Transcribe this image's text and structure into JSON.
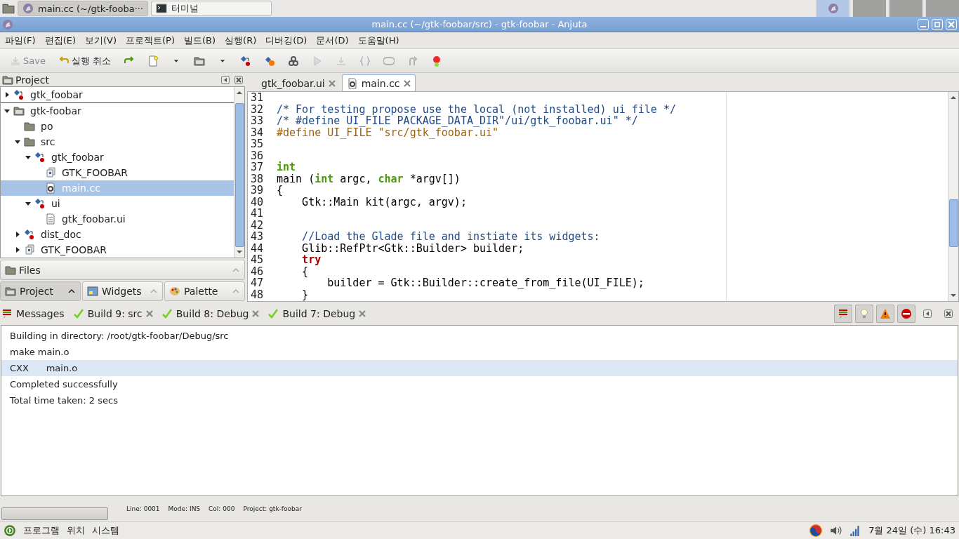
{
  "taskbar": {
    "tasks": [
      {
        "label": "main.cc (~/gtk-fooba···",
        "kind": "app",
        "selected": true
      },
      {
        "label": "터미널",
        "kind": "terminal",
        "selected": false
      }
    ],
    "workspaces": [
      {
        "selected": true
      },
      {
        "selected": false
      },
      {
        "selected": false
      },
      {
        "selected": false
      }
    ]
  },
  "window": {
    "title": "main.cc (~/gtk-foobar/src) - gtk-foobar - Anjuta"
  },
  "menu": [
    "파일(F)",
    "편집(E)",
    "보기(V)",
    "프로젝트(P)",
    "빌드(B)",
    "실행(R)",
    "디버깅(D)",
    "문서(D)",
    "도움말(H)"
  ],
  "toolbar": [
    {
      "kind": "save",
      "label": "Save",
      "disabled": true
    },
    {
      "kind": "undo",
      "label": "실행 취소",
      "disabled": false
    },
    {
      "kind": "redo",
      "disabled": false
    },
    {
      "kind": "new",
      "disabled": false
    },
    {
      "kind": "caret",
      "disabled": false
    },
    {
      "kind": "open",
      "disabled": false
    },
    {
      "kind": "caret",
      "disabled": false
    },
    {
      "kind": "target",
      "disabled": false
    },
    {
      "kind": "build",
      "disabled": false
    },
    {
      "kind": "gears",
      "disabled": false
    },
    {
      "kind": "play",
      "disabled": true
    },
    {
      "kind": "download",
      "disabled": true
    },
    {
      "kind": "braces",
      "disabled": true
    },
    {
      "kind": "loop",
      "disabled": true
    },
    {
      "kind": "loopup",
      "disabled": true
    },
    {
      "kind": "breakpoint",
      "disabled": false
    }
  ],
  "project_panel": {
    "title": "Project",
    "pinned": {
      "label": "gtk_foobar",
      "kind": "target",
      "expanded": false
    },
    "tree": [
      {
        "label": "gtk-foobar",
        "kind": "project",
        "expanded": true,
        "selected": false,
        "children": [
          {
            "label": "po",
            "kind": "folder",
            "selected": false
          },
          {
            "label": "src",
            "kind": "folder",
            "expanded": true,
            "selected": false,
            "children": [
              {
                "label": "gtk_foobar",
                "kind": "target",
                "expanded": true,
                "selected": false,
                "children": [
                  {
                    "label": "GTK_FOOBAR",
                    "kind": "lib",
                    "selected": false
                  },
                  {
                    "label": "main.cc",
                    "kind": "source",
                    "selected": true
                  }
                ]
              },
              {
                "label": "ui",
                "kind": "target",
                "expanded": true,
                "selected": false,
                "children": [
                  {
                    "label": "gtk_foobar.ui",
                    "kind": "file",
                    "selected": false
                  }
                ]
              }
            ]
          },
          {
            "label": "dist_doc",
            "kind": "target",
            "expanded": false,
            "selected": false
          },
          {
            "label": "GTK_FOOBAR",
            "kind": "lib",
            "expanded": false,
            "selected": false
          }
        ]
      }
    ],
    "files_label": "Files",
    "tabs": [
      {
        "label": "Project",
        "kind": "project",
        "selected": true
      },
      {
        "label": "Widgets",
        "kind": "widgets",
        "selected": false
      },
      {
        "label": "Palette",
        "kind": "palette",
        "selected": false
      }
    ]
  },
  "editor": {
    "tabs": [
      {
        "label": "gtk_foobar.ui",
        "kind": "plain",
        "selected": false
      },
      {
        "label": "main.cc",
        "kind": "source",
        "selected": true
      }
    ],
    "lines": [
      {
        "number": "31"
      },
      {
        "number": "32",
        "segments": [
          {
            "text": "/* For testing propose use the local (not installed) ui file */",
            "kind": "comment"
          }
        ]
      },
      {
        "number": "33",
        "segments": [
          {
            "text": "/* #define UI_FILE PACKAGE_DATA_DIR\"/ui/gtk_foobar.ui\" */",
            "kind": "comment"
          }
        ]
      },
      {
        "number": "34",
        "segments": [
          {
            "text": "#define UI_FILE \"src/gtk_foobar.ui\"",
            "kind": "preproc"
          }
        ]
      },
      {
        "number": "35"
      },
      {
        "number": "36"
      },
      {
        "number": "37",
        "segments": [
          {
            "text": "int",
            "kind": "type"
          }
        ]
      },
      {
        "number": "38",
        "segments": [
          {
            "text": "main (",
            "kind": "plain"
          },
          {
            "text": "int",
            "kind": "type"
          },
          {
            "text": " argc, ",
            "kind": "plain"
          },
          {
            "text": "char",
            "kind": "type"
          },
          {
            "text": " *argv[])",
            "kind": "plain"
          }
        ]
      },
      {
        "number": "39",
        "segments": [
          {
            "text": "{",
            "kind": "plain"
          }
        ]
      },
      {
        "number": "40",
        "segments": [
          {
            "text": "    Gtk::Main kit(argc, argv);",
            "kind": "plain"
          }
        ]
      },
      {
        "number": "41"
      },
      {
        "number": "42"
      },
      {
        "number": "43",
        "segments": [
          {
            "text": "    //Load the Glade file and instiate its widgets:",
            "kind": "comment"
          }
        ]
      },
      {
        "number": "44",
        "segments": [
          {
            "text": "    Glib::RefPtr<Gtk::Builder> builder;",
            "kind": "plain"
          }
        ]
      },
      {
        "number": "45",
        "segments": [
          {
            "text": "    try",
            "kind": "keyword"
          }
        ]
      },
      {
        "number": "46",
        "segments": [
          {
            "text": "    {",
            "kind": "plain"
          }
        ]
      },
      {
        "number": "47",
        "segments": [
          {
            "text": "        builder = Gtk::Builder::create_from_file(UI_FILE);",
            "kind": "plain"
          }
        ]
      },
      {
        "number": "48",
        "segments": [
          {
            "text": "    }",
            "kind": "plain"
          }
        ]
      }
    ]
  },
  "messages": {
    "title": "Messages",
    "tabs": [
      {
        "label": "Build 9: src"
      },
      {
        "label": "Build 8: Debug"
      },
      {
        "label": "Build 7: Debug"
      }
    ],
    "filters": [
      {
        "kind": "list"
      },
      {
        "kind": "bulb"
      },
      {
        "kind": "warning"
      },
      {
        "kind": "stop"
      }
    ],
    "rows": [
      {
        "text": "Building in directory: /root/gtk-foobar/Debug/src",
        "selected": false
      },
      {
        "text": "make main.o",
        "selected": false
      },
      {
        "text": "CXX      main.o",
        "selected": true
      },
      {
        "text": "Completed successfully",
        "selected": false
      },
      {
        "text": "Total time taken: 2 secs",
        "selected": false
      }
    ]
  },
  "status": {
    "progress": {
      "level": 0
    },
    "fields": [
      "Line: 0001",
      "Mode: INS",
      "Col: 000",
      "Project: gtk-foobar"
    ]
  },
  "panel": {
    "menus": [
      "프로그램",
      "위치",
      "시스템"
    ],
    "clock": "7월 24일 (수) 16:43"
  }
}
